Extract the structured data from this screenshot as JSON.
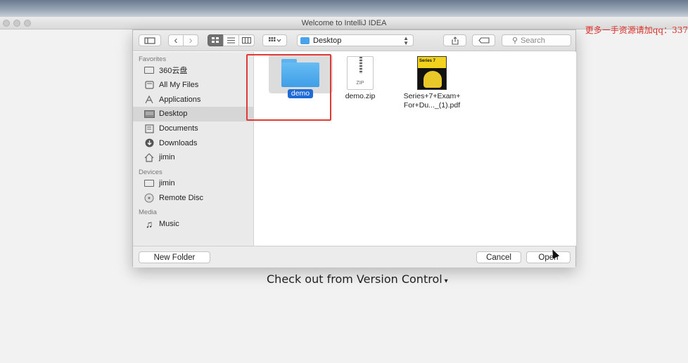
{
  "window": {
    "title": "Welcome to IntelliJ IDEA"
  },
  "watermark": "更多一手资源请加qq：337",
  "background_action": {
    "label": "Check out from Version Control",
    "caret": "▾"
  },
  "toolbar": {
    "path": "Desktop",
    "search_placeholder": "Search",
    "back_glyph": "‹",
    "forward_glyph": "›"
  },
  "sidebar": {
    "sections": [
      {
        "header": "Favorites",
        "items": [
          {
            "label": "360云盘",
            "icon": "drive-icon"
          },
          {
            "label": "All My Files",
            "icon": "files-icon"
          },
          {
            "label": "Applications",
            "icon": "applications-icon"
          },
          {
            "label": "Desktop",
            "icon": "desktop-icon",
            "selected": true
          },
          {
            "label": "Documents",
            "icon": "documents-icon"
          },
          {
            "label": "Downloads",
            "icon": "downloads-icon"
          },
          {
            "label": "jimin",
            "icon": "home-icon"
          }
        ]
      },
      {
        "header": "Devices",
        "items": [
          {
            "label": "jimin",
            "icon": "computer-icon"
          },
          {
            "label": "Remote Disc",
            "icon": "disc-icon"
          }
        ]
      },
      {
        "header": "Media",
        "items": [
          {
            "label": "Music",
            "icon": "music-icon"
          }
        ]
      }
    ]
  },
  "files": [
    {
      "name": "demo",
      "type": "folder",
      "selected": true
    },
    {
      "name": "demo.zip",
      "type": "zip",
      "badge": "ZIP"
    },
    {
      "name": "Series+7+Exam+\nFor+Du..._(1).pdf",
      "type": "pdf",
      "cover_text": "Series 7"
    }
  ],
  "footer": {
    "new_folder": "New Folder",
    "cancel": "Cancel",
    "open": "Open"
  },
  "colors": {
    "selection": "#1e6ad7",
    "highlight_box": "#e03a36",
    "watermark": "#d8322a"
  }
}
